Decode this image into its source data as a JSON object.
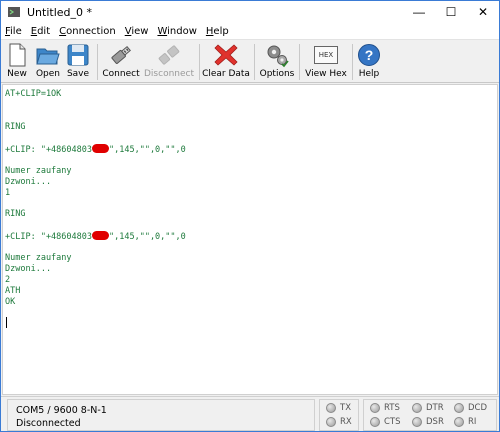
{
  "window": {
    "title": "Untitled_0 *",
    "minimize": "—",
    "maximize": "☐",
    "close": "✕"
  },
  "menu": [
    {
      "label": "File",
      "mnemonic": "F",
      "rest": "ile"
    },
    {
      "label": "Edit",
      "mnemonic": "E",
      "rest": "dit"
    },
    {
      "label": "Connection",
      "mnemonic": "C",
      "rest": "onnection"
    },
    {
      "label": "View",
      "mnemonic": "V",
      "rest": "iew"
    },
    {
      "label": "Window",
      "mnemonic": "W",
      "rest": "indow"
    },
    {
      "label": "Help",
      "mnemonic": "H",
      "rest": "elp"
    }
  ],
  "toolbar": {
    "new": "New",
    "open": "Open",
    "save": "Save",
    "connect": "Connect",
    "disconnect": "Disconnect",
    "clear_data": "Clear Data",
    "options": "Options",
    "view_hex": "View Hex",
    "help": "Help",
    "hex_icon_text": "HEX",
    "help_icon_text": "?"
  },
  "terminal": {
    "lines": [
      "AT+CLIP=1OK",
      "",
      "",
      "RING",
      "",
      "+CLIP: \"+48604803",
      "",
      "Numer zaufany",
      "Dzwoni...",
      "1",
      "",
      "RING",
      "",
      "+CLIP: \"+48604803",
      "",
      "Numer zaufany",
      "Dzwoni...",
      "2",
      "ATH",
      "OK"
    ],
    "clip_suffix": "\",145,\"\",0,\"\",0"
  },
  "status": {
    "port": "COM5 / 9600 8-N-1",
    "connection": "Disconnected"
  },
  "signals": {
    "tx": "TX",
    "rx": "RX",
    "rts": "RTS",
    "cts": "CTS",
    "dtr": "DTR",
    "dsr": "DSR",
    "dcd": "DCD",
    "ri": "RI"
  },
  "colors": {
    "terminal_text": "#1e7a3c",
    "redaction": "#e00000"
  }
}
